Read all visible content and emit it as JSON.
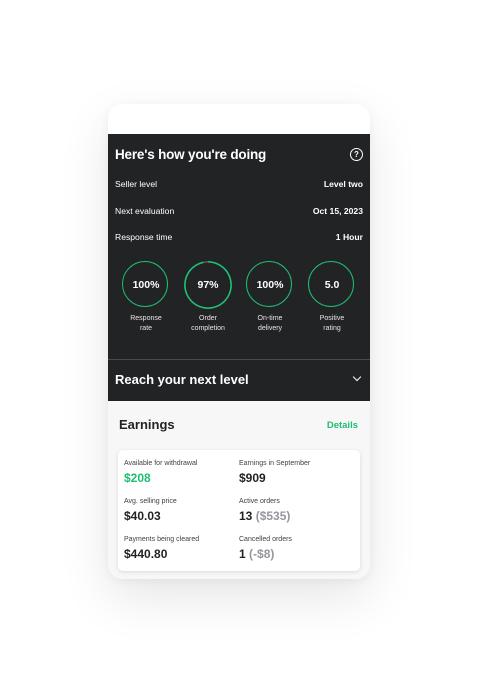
{
  "header": {
    "title": "Here's how you're doing",
    "help_icon": "question-circle-icon"
  },
  "stats": [
    {
      "label": "Seller level",
      "value": "Level two"
    },
    {
      "label": "Next evaluation",
      "value": "Oct 15, 2023"
    },
    {
      "label": "Response time",
      "value": "1 Hour"
    }
  ],
  "metrics": [
    {
      "value": "100%",
      "label_line1": "Response",
      "label_line2": "rate",
      "ring_fraction": 1.0
    },
    {
      "value": "97%",
      "label_line1": "Order",
      "label_line2": "completion",
      "ring_fraction": 0.97
    },
    {
      "value": "100%",
      "label_line1": "On-time",
      "label_line2": "delivery",
      "ring_fraction": 1.0
    },
    {
      "value": "5.0",
      "label_line1": "Positive",
      "label_line2": "rating",
      "ring_fraction": 1.0
    }
  ],
  "next_level": {
    "title": "Reach your next level",
    "icon": "chevron-down-icon"
  },
  "earnings": {
    "title": "Earnings",
    "details_link": "Details",
    "items": [
      {
        "label": "Available for withdrawal",
        "value": "$208",
        "extra": ""
      },
      {
        "label": "Earnings in September",
        "value": "$909",
        "extra": ""
      },
      {
        "label": "Avg. selling price",
        "value": "$40.03",
        "extra": ""
      },
      {
        "label": "Active orders",
        "value": "13",
        "extra": "($535)"
      },
      {
        "label": "Payments being cleared",
        "value": "$440.80",
        "extra": ""
      },
      {
        "label": "Cancelled orders",
        "value": "1",
        "extra": "(-$8)"
      }
    ]
  },
  "colors": {
    "accent": "#1dbf73",
    "dark_panel": "#222325",
    "muted_text": "#95979d"
  }
}
